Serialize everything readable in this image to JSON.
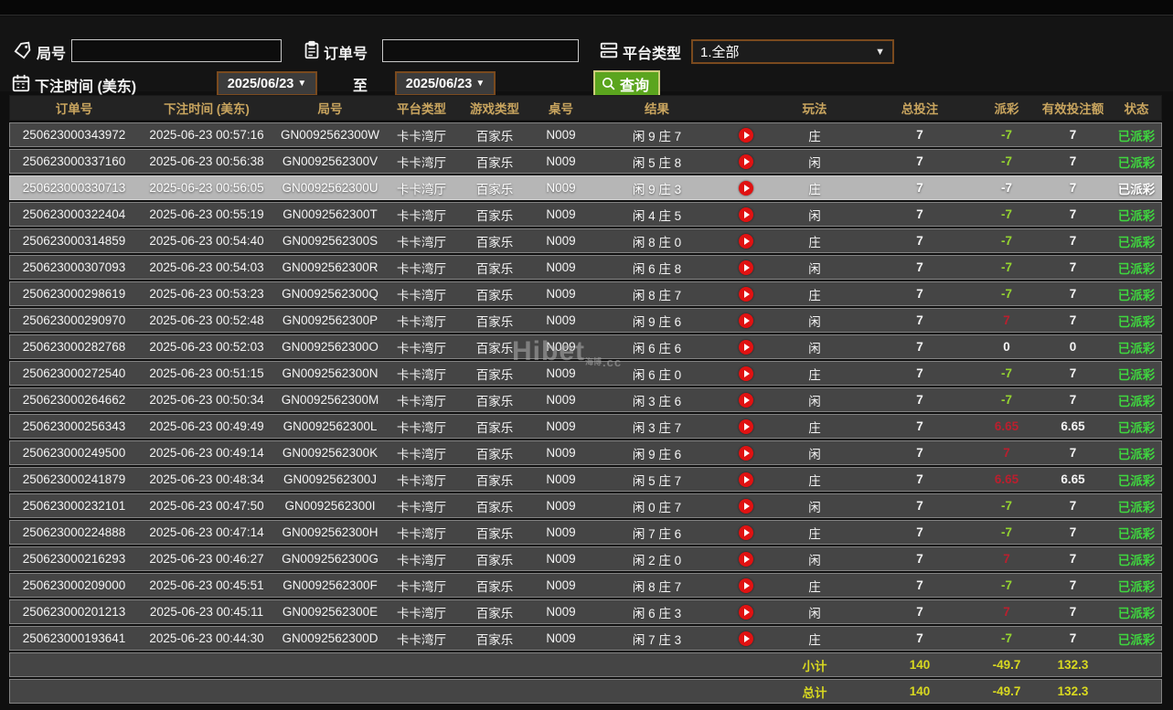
{
  "filters": {
    "round_label": "局号",
    "round_value": "",
    "order_label": "订单号",
    "order_value": "",
    "platform_label": "平台类型",
    "platform_value": "1.全部",
    "bet_time_label": "下注时间 (美东)",
    "date_from": "2025/06/23",
    "date_to": "2025/06/23",
    "to_label": "至",
    "query_label": "查询",
    "caret": "▼"
  },
  "watermark": {
    "text": "Hibet",
    "suffix": ".cc",
    "mini": "海博"
  },
  "colors": {
    "header_gold": "#c9a55f",
    "row_bg": "#454545",
    "selected_row_bg": "#b6b6b6",
    "payout_negative_green": "#95d431",
    "payout_positive_red": "#bb1f2e",
    "status_green": "#3fd63f",
    "totals_yellow": "#d9d920",
    "query_button_green": "#5ba51e",
    "dropdown_border_brown": "#7a4a1e",
    "play_icon_red": "#e01212"
  },
  "table": {
    "columns": [
      "订单号",
      "下注时间 (美东)",
      "局号",
      "平台类型",
      "游戏类型",
      "桌号",
      "结果",
      "",
      "玩法",
      "总投注",
      "派彩",
      "有效投注额",
      "状态"
    ],
    "rows": [
      {
        "order": "250623000343972",
        "time": "2025-06-23 00:57:16",
        "round": "GN0092562300W",
        "platform": "卡卡湾厅",
        "game": "百家乐",
        "table_no": "N009",
        "result": "闲 9 庄 7",
        "play_type": "庄",
        "bet": "7",
        "payout": "-7",
        "payout_type": "neg",
        "valid": "7",
        "status": "已派彩",
        "selected": false
      },
      {
        "order": "250623000337160",
        "time": "2025-06-23 00:56:38",
        "round": "GN0092562300V",
        "platform": "卡卡湾厅",
        "game": "百家乐",
        "table_no": "N009",
        "result": "闲 5 庄 8",
        "play_type": "闲",
        "bet": "7",
        "payout": "-7",
        "payout_type": "neg",
        "valid": "7",
        "status": "已派彩",
        "selected": false
      },
      {
        "order": "250623000330713",
        "time": "2025-06-23 00:56:05",
        "round": "GN0092562300U",
        "platform": "卡卡湾厅",
        "game": "百家乐",
        "table_no": "N009",
        "result": "闲 9 庄 3",
        "play_type": "庄",
        "bet": "7",
        "payout": "-7",
        "payout_type": "neg",
        "valid": "7",
        "status": "已派彩",
        "selected": true
      },
      {
        "order": "250623000322404",
        "time": "2025-06-23 00:55:19",
        "round": "GN0092562300T",
        "platform": "卡卡湾厅",
        "game": "百家乐",
        "table_no": "N009",
        "result": "闲 4 庄 5",
        "play_type": "闲",
        "bet": "7",
        "payout": "-7",
        "payout_type": "neg",
        "valid": "7",
        "status": "已派彩",
        "selected": false
      },
      {
        "order": "250623000314859",
        "time": "2025-06-23 00:54:40",
        "round": "GN0092562300S",
        "platform": "卡卡湾厅",
        "game": "百家乐",
        "table_no": "N009",
        "result": "闲 8 庄 0",
        "play_type": "庄",
        "bet": "7",
        "payout": "-7",
        "payout_type": "neg",
        "valid": "7",
        "status": "已派彩",
        "selected": false
      },
      {
        "order": "250623000307093",
        "time": "2025-06-23 00:54:03",
        "round": "GN0092562300R",
        "platform": "卡卡湾厅",
        "game": "百家乐",
        "table_no": "N009",
        "result": "闲 6 庄 8",
        "play_type": "闲",
        "bet": "7",
        "payout": "-7",
        "payout_type": "neg",
        "valid": "7",
        "status": "已派彩",
        "selected": false
      },
      {
        "order": "250623000298619",
        "time": "2025-06-23 00:53:23",
        "round": "GN0092562300Q",
        "platform": "卡卡湾厅",
        "game": "百家乐",
        "table_no": "N009",
        "result": "闲 8 庄 7",
        "play_type": "庄",
        "bet": "7",
        "payout": "-7",
        "payout_type": "neg",
        "valid": "7",
        "status": "已派彩",
        "selected": false
      },
      {
        "order": "250623000290970",
        "time": "2025-06-23 00:52:48",
        "round": "GN0092562300P",
        "platform": "卡卡湾厅",
        "game": "百家乐",
        "table_no": "N009",
        "result": "闲 9 庄 6",
        "play_type": "闲",
        "bet": "7",
        "payout": "7",
        "payout_type": "pos",
        "valid": "7",
        "status": "已派彩",
        "selected": false
      },
      {
        "order": "250623000282768",
        "time": "2025-06-23 00:52:03",
        "round": "GN0092562300O",
        "platform": "卡卡湾厅",
        "game": "百家乐",
        "table_no": "N009",
        "result": "闲 6 庄 6",
        "play_type": "闲",
        "bet": "7",
        "payout": "0",
        "payout_type": "zero",
        "valid": "0",
        "status": "已派彩",
        "selected": false
      },
      {
        "order": "250623000272540",
        "time": "2025-06-23 00:51:15",
        "round": "GN0092562300N",
        "platform": "卡卡湾厅",
        "game": "百家乐",
        "table_no": "N009",
        "result": "闲 6 庄 0",
        "play_type": "庄",
        "bet": "7",
        "payout": "-7",
        "payout_type": "neg",
        "valid": "7",
        "status": "已派彩",
        "selected": false
      },
      {
        "order": "250623000264662",
        "time": "2025-06-23 00:50:34",
        "round": "GN0092562300M",
        "platform": "卡卡湾厅",
        "game": "百家乐",
        "table_no": "N009",
        "result": "闲 3 庄 6",
        "play_type": "闲",
        "bet": "7",
        "payout": "-7",
        "payout_type": "neg",
        "valid": "7",
        "status": "已派彩",
        "selected": false
      },
      {
        "order": "250623000256343",
        "time": "2025-06-23 00:49:49",
        "round": "GN0092562300L",
        "platform": "卡卡湾厅",
        "game": "百家乐",
        "table_no": "N009",
        "result": "闲 3 庄 7",
        "play_type": "庄",
        "bet": "7",
        "payout": "6.65",
        "payout_type": "pos",
        "valid": "6.65",
        "status": "已派彩",
        "selected": false
      },
      {
        "order": "250623000249500",
        "time": "2025-06-23 00:49:14",
        "round": "GN0092562300K",
        "platform": "卡卡湾厅",
        "game": "百家乐",
        "table_no": "N009",
        "result": "闲 9 庄 6",
        "play_type": "闲",
        "bet": "7",
        "payout": "7",
        "payout_type": "pos",
        "valid": "7",
        "status": "已派彩",
        "selected": false
      },
      {
        "order": "250623000241879",
        "time": "2025-06-23 00:48:34",
        "round": "GN0092562300J",
        "platform": "卡卡湾厅",
        "game": "百家乐",
        "table_no": "N009",
        "result": "闲 5 庄 7",
        "play_type": "庄",
        "bet": "7",
        "payout": "6.65",
        "payout_type": "pos",
        "valid": "6.65",
        "status": "已派彩",
        "selected": false
      },
      {
        "order": "250623000232101",
        "time": "2025-06-23 00:47:50",
        "round": "GN0092562300I",
        "platform": "卡卡湾厅",
        "game": "百家乐",
        "table_no": "N009",
        "result": "闲 0 庄 7",
        "play_type": "闲",
        "bet": "7",
        "payout": "-7",
        "payout_type": "neg",
        "valid": "7",
        "status": "已派彩",
        "selected": false
      },
      {
        "order": "250623000224888",
        "time": "2025-06-23 00:47:14",
        "round": "GN0092562300H",
        "platform": "卡卡湾厅",
        "game": "百家乐",
        "table_no": "N009",
        "result": "闲 7 庄 6",
        "play_type": "庄",
        "bet": "7",
        "payout": "-7",
        "payout_type": "neg",
        "valid": "7",
        "status": "已派彩",
        "selected": false
      },
      {
        "order": "250623000216293",
        "time": "2025-06-23 00:46:27",
        "round": "GN0092562300G",
        "platform": "卡卡湾厅",
        "game": "百家乐",
        "table_no": "N009",
        "result": "闲 2 庄 0",
        "play_type": "闲",
        "bet": "7",
        "payout": "7",
        "payout_type": "pos",
        "valid": "7",
        "status": "已派彩",
        "selected": false
      },
      {
        "order": "250623000209000",
        "time": "2025-06-23 00:45:51",
        "round": "GN0092562300F",
        "platform": "卡卡湾厅",
        "game": "百家乐",
        "table_no": "N009",
        "result": "闲 8 庄 7",
        "play_type": "庄",
        "bet": "7",
        "payout": "-7",
        "payout_type": "neg",
        "valid": "7",
        "status": "已派彩",
        "selected": false
      },
      {
        "order": "250623000201213",
        "time": "2025-06-23 00:45:11",
        "round": "GN0092562300E",
        "platform": "卡卡湾厅",
        "game": "百家乐",
        "table_no": "N009",
        "result": "闲 6 庄 3",
        "play_type": "闲",
        "bet": "7",
        "payout": "7",
        "payout_type": "pos",
        "valid": "7",
        "status": "已派彩",
        "selected": false
      },
      {
        "order": "250623000193641",
        "time": "2025-06-23 00:44:30",
        "round": "GN0092562300D",
        "platform": "卡卡湾厅",
        "game": "百家乐",
        "table_no": "N009",
        "result": "闲 7 庄 3",
        "play_type": "庄",
        "bet": "7",
        "payout": "-7",
        "payout_type": "neg",
        "valid": "7",
        "status": "已派彩",
        "selected": false
      }
    ],
    "subtotal": {
      "label": "小计",
      "bet": "140",
      "payout": "-49.7",
      "valid": "132.3"
    },
    "total": {
      "label": "总计",
      "bet": "140",
      "payout": "-49.7",
      "valid": "132.3"
    }
  }
}
